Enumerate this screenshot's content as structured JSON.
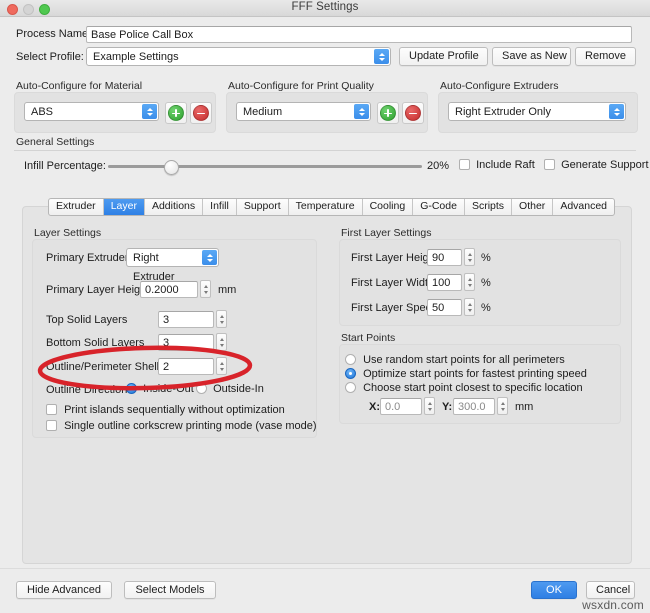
{
  "window": {
    "title": "FFF Settings",
    "traffic_lights": [
      "close-button",
      "minimize-button",
      "maximize-button"
    ]
  },
  "top_form": {
    "process_name_label": "Process Name:",
    "process_name_value": "Base Police Call Box",
    "select_profile_label": "Select Profile:",
    "select_profile_value": "Example Settings",
    "update_profile_label": "Update Profile",
    "save_as_new_label": "Save as New",
    "remove_label": "Remove"
  },
  "auto_configure": {
    "material": {
      "title": "Auto-Configure for Material",
      "value": "ABS",
      "add_icon": "plus-circle-icon",
      "remove_icon": "minus-circle-icon"
    },
    "print_quality": {
      "title": "Auto-Configure for Print Quality",
      "value": "Medium",
      "add_icon": "plus-circle-icon",
      "remove_icon": "minus-circle-icon"
    },
    "extruders": {
      "title": "Auto-Configure Extruders",
      "value": "Right Extruder Only"
    }
  },
  "general_settings": {
    "title": "General Settings",
    "infill_label": "Infill Percentage:",
    "infill_value": "20%",
    "infill_percent": 20,
    "include_raft_label": "Include Raft",
    "include_raft_checked": false,
    "generate_support_label": "Generate Support",
    "generate_support_checked": false
  },
  "tabs": [
    {
      "label": "Extruder",
      "active": false
    },
    {
      "label": "Layer",
      "active": true
    },
    {
      "label": "Additions",
      "active": false
    },
    {
      "label": "Infill",
      "active": false
    },
    {
      "label": "Support",
      "active": false
    },
    {
      "label": "Temperature",
      "active": false
    },
    {
      "label": "Cooling",
      "active": false
    },
    {
      "label": "G-Code",
      "active": false
    },
    {
      "label": "Scripts",
      "active": false
    },
    {
      "label": "Other",
      "active": false
    },
    {
      "label": "Advanced",
      "active": false
    }
  ],
  "layer_settings": {
    "title": "Layer Settings",
    "primary_extruder_label": "Primary Extruder",
    "primary_extruder_value": "Right Extruder",
    "primary_layer_height_label": "Primary Layer Height",
    "primary_layer_height_value": "0.2000",
    "primary_layer_height_unit": "mm",
    "top_solid_layers_label": "Top Solid Layers",
    "top_solid_layers_value": "3",
    "bottom_solid_layers_label": "Bottom Solid Layers",
    "bottom_solid_layers_value": "3",
    "outline_shells_label": "Outline/Perimeter Shells",
    "outline_shells_value": "2",
    "outline_direction_label": "Outline Direction:",
    "outline_direction_inside_out": "Inside-Out",
    "outline_direction_outside_in": "Outside-In",
    "outline_direction_selected": "Inside-Out",
    "print_islands_label": "Print islands sequentially without optimization",
    "print_islands_checked": false,
    "vase_mode_label": "Single outline corkscrew printing mode (vase mode)",
    "vase_mode_checked": false
  },
  "first_layer_settings": {
    "title": "First Layer Settings",
    "height_label": "First Layer Height",
    "height_value": "90",
    "height_unit": "%",
    "width_label": "First Layer Width",
    "width_value": "100",
    "width_unit": "%",
    "speed_label": "First Layer Speed",
    "speed_value": "50",
    "speed_unit": "%"
  },
  "start_points": {
    "title": "Start Points",
    "option_random": "Use random start points for all perimeters",
    "option_optimize": "Optimize start points for fastest printing speed",
    "option_specific": "Choose start point closest to specific location",
    "selected": "Optimize start points for fastest printing speed",
    "x_label": "X:",
    "x_value": "0.0",
    "y_label": "Y:",
    "y_value": "300.0",
    "unit": "mm"
  },
  "footer": {
    "hide_advanced_label": "Hide Advanced",
    "select_models_label": "Select Models",
    "ok_label": "OK",
    "cancel_label": "Cancel"
  },
  "annotation": {
    "shape": "red-ellipse-highlight",
    "color": "#d8232a",
    "target": "Outline/Perimeter Shells"
  },
  "watermark": {
    "text": "wsxdn.com"
  }
}
